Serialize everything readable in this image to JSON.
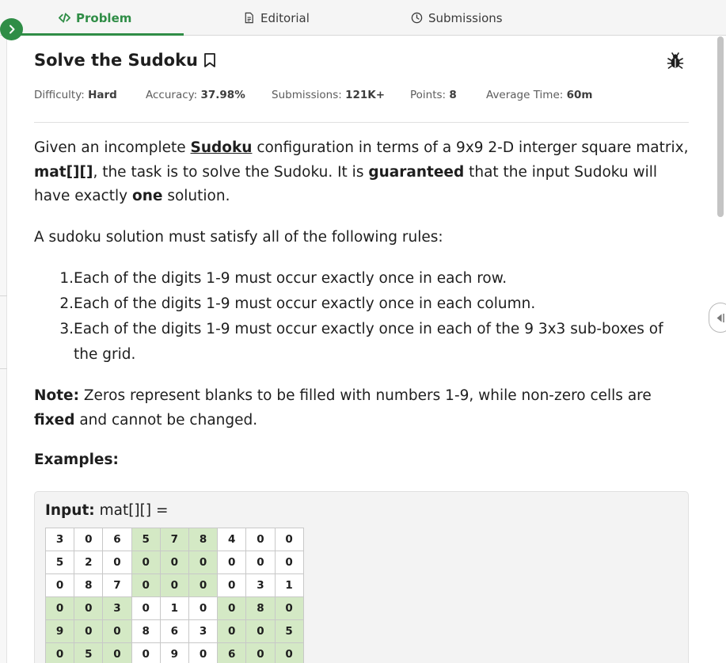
{
  "tabs": [
    {
      "label": "Problem",
      "icon": "code-icon",
      "active": true
    },
    {
      "label": "Editorial",
      "icon": "document-icon",
      "active": false
    },
    {
      "label": "Submissions",
      "icon": "clock-icon",
      "active": false
    }
  ],
  "problem": {
    "title": "Solve the Sudoku",
    "meta": {
      "difficulty_label": "Difficulty:",
      "difficulty": "Hard",
      "accuracy_label": "Accuracy:",
      "accuracy": "37.98%",
      "submissions_label": "Submissions:",
      "submissions": "121K+",
      "points_label": "Points:",
      "points": "8",
      "avg_time_label": "Average Time:",
      "avg_time": "60m"
    },
    "desc": {
      "p1": "Given an incomplete ",
      "sudoku_link": "Sudoku",
      "p2": " configuration in terms of a 9x9  2-D interger square matrix, ",
      "mat": "mat[][]",
      "p3": ", the task is to solve the Sudoku. It is ",
      "guaranteed": "guaranteed",
      "p4": " that the input Sudoku will have exactly ",
      "one": "one",
      "p5": " solution."
    },
    "rules_intro": "A sudoku solution must satisfy all of the following rules:",
    "rules": [
      "Each of the digits 1-9 must occur exactly once in each row.",
      "Each of the digits 1-9 must occur exactly once in each column.",
      "Each of the digits 1-9 must occur exactly once in each of the 9 3x3 sub-boxes of the grid."
    ],
    "rule_numbers": [
      "1.",
      "2.",
      "3."
    ],
    "note": {
      "label": "Note:",
      "t1": " Zeros represent blanks to be filled with numbers 1-9, while non-zero cells are ",
      "fixed": "fixed",
      "t2": " and cannot be changed."
    },
    "examples_heading": "Examples:",
    "example": {
      "input_label": "Input:",
      "input_expr": " mat[][] =",
      "grid": [
        [
          "3",
          "0",
          "6",
          "5",
          "7",
          "8",
          "4",
          "0",
          "0"
        ],
        [
          "5",
          "2",
          "0",
          "0",
          "0",
          "0",
          "0",
          "0",
          "0"
        ],
        [
          "0",
          "8",
          "7",
          "0",
          "0",
          "0",
          "0",
          "3",
          "1"
        ],
        [
          "0",
          "0",
          "3",
          "0",
          "1",
          "0",
          "0",
          "8",
          "0"
        ],
        [
          "9",
          "0",
          "0",
          "8",
          "6",
          "3",
          "0",
          "0",
          "5"
        ],
        [
          "0",
          "5",
          "0",
          "0",
          "9",
          "0",
          "6",
          "0",
          "0"
        ]
      ]
    }
  },
  "colors": {
    "accent": "#2f8d46",
    "box_fill": "#d4e9c5"
  }
}
